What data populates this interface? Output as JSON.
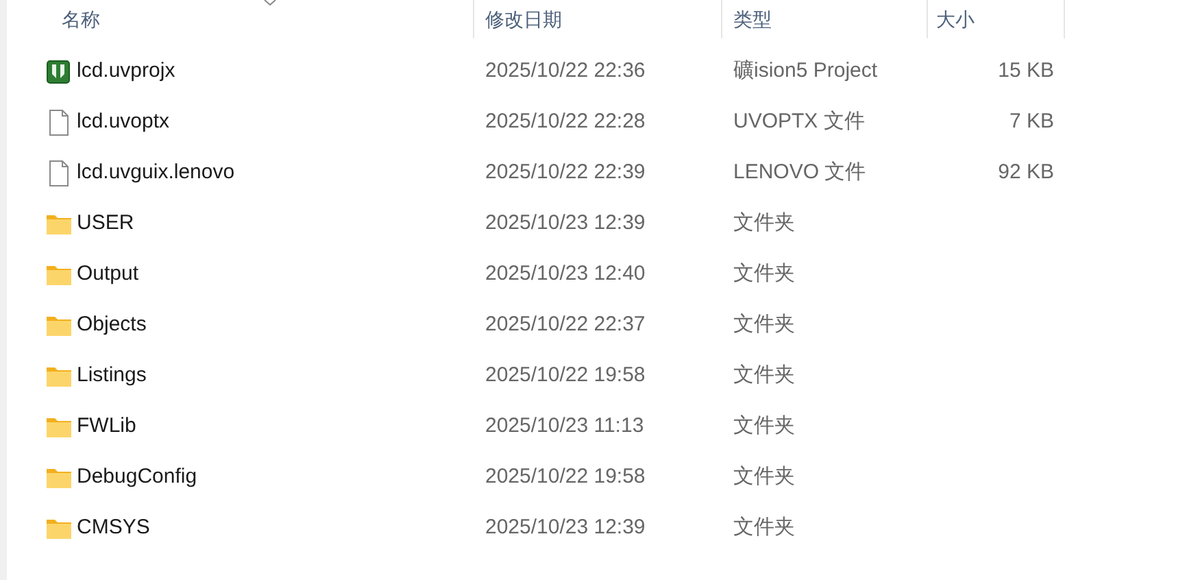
{
  "columns": [
    "名称",
    "修改日期",
    "类型",
    "大小"
  ],
  "rows": [
    {
      "kind": "project",
      "name": "lcd.uvprojx",
      "modified": "2025/10/22 22:36",
      "type": "礦ision5 Project",
      "size": "15 KB"
    },
    {
      "kind": "file",
      "name": "lcd.uvoptx",
      "modified": "2025/10/22 22:28",
      "type": "UVOPTX 文件",
      "size": "7 KB"
    },
    {
      "kind": "file",
      "name": "lcd.uvguix.lenovo",
      "modified": "2025/10/22 22:39",
      "type": "LENOVO 文件",
      "size": "92 KB"
    },
    {
      "kind": "folder",
      "name": "USER",
      "modified": "2025/10/23 12:39",
      "type": "文件夹"
    },
    {
      "kind": "folder",
      "name": "Output",
      "modified": "2025/10/23 12:40",
      "type": "文件夹"
    },
    {
      "kind": "folder",
      "name": "Objects",
      "modified": "2025/10/22 22:37",
      "type": "文件夹"
    },
    {
      "kind": "folder",
      "name": "Listings",
      "modified": "2025/10/22 19:58",
      "type": "文件夹"
    },
    {
      "kind": "folder",
      "name": "FWLib",
      "modified": "2025/10/23 11:13",
      "type": "文件夹"
    },
    {
      "kind": "folder",
      "name": "DebugConfig",
      "modified": "2025/10/22 19:58",
      "type": "文件夹"
    },
    {
      "kind": "folder",
      "name": "CMSYS",
      "modified": "2025/10/23 12:39",
      "type": "文件夹"
    }
  ]
}
